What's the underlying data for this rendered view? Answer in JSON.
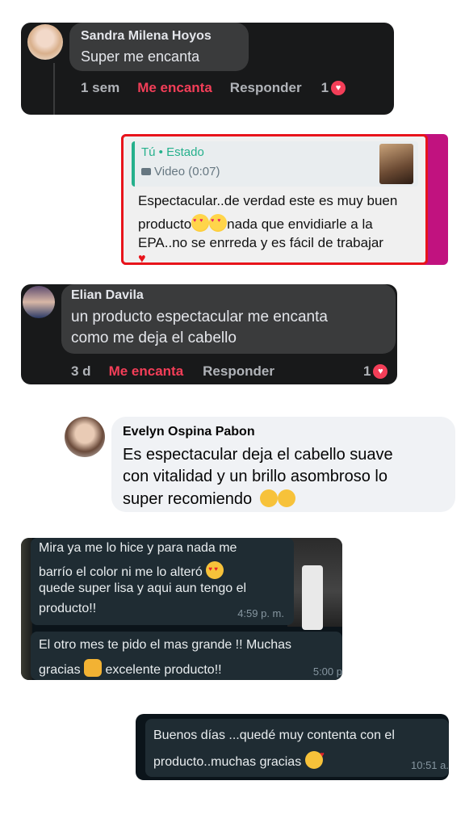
{
  "comment1": {
    "name": "Sandra Milena Hoyos",
    "text": "Super me encanta",
    "time": "1 sem",
    "love": "Me encanta",
    "reply": "Responder",
    "reactions": "1"
  },
  "whatsapp_reply": {
    "sender": "Tú • Estado",
    "media": "Video (0:07)",
    "line1": "Espectacular..de verdad este es muy buen",
    "line2a": "producto",
    "line2b": "nada que envidiarle a la",
    "line3": "EPA..no se enrreda y es fácil de trabajar"
  },
  "comment2": {
    "name": "Elian Davila",
    "line1": "un producto espectacular me encanta",
    "line2": "como me deja el cabello",
    "time": "3 d",
    "love": "Me encanta",
    "reply": "Responder",
    "reactions": "1"
  },
  "comment3": {
    "name": "Evelyn Ospina Pabon",
    "line1": "Es espectacular deja el cabello suave",
    "line2": "con vitalidad y un brillo asombroso lo",
    "line3": "super recomiendo"
  },
  "chat1": {
    "msg1": {
      "line1": "Mira ya me lo hice y para nada me",
      "line2": "barrío el color ni me lo alteró",
      "line3": "quede super lisa y aqui aun tengo el",
      "line4": "producto!!",
      "time": "4:59 p. m."
    },
    "msg2": {
      "line1": "El otro mes te pido el mas grande !! Muchas",
      "line2a": "gracias",
      "line2b": "excelente producto!!",
      "time": "5:00 p"
    }
  },
  "chat2": {
    "line1": "Buenos días ...quedé muy contenta con el",
    "line2": "producto..muchas gracias",
    "time": "10:51 a."
  },
  "colors": {
    "love_red": "#f33e58",
    "whatsapp_green": "#25b08c",
    "highlight_border": "#e8141b"
  }
}
